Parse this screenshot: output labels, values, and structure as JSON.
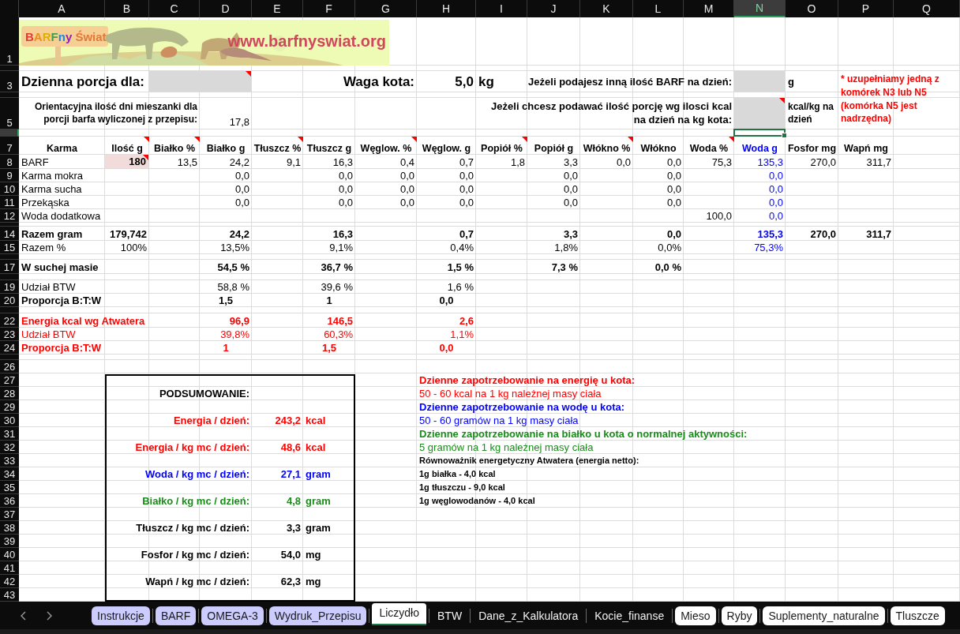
{
  "column_headers": [
    {
      "label": "A",
      "selected": false
    },
    {
      "label": "B",
      "selected": false
    },
    {
      "label": "C",
      "selected": false
    },
    {
      "label": "D",
      "selected": false
    },
    {
      "label": "E",
      "selected": false
    },
    {
      "label": "F",
      "selected": false
    },
    {
      "label": "G",
      "selected": false
    },
    {
      "label": "H",
      "selected": false
    },
    {
      "label": "I",
      "selected": false
    },
    {
      "label": "J",
      "selected": false
    },
    {
      "label": "K",
      "selected": false
    },
    {
      "label": "L",
      "selected": false
    },
    {
      "label": "M",
      "selected": false
    },
    {
      "label": "N",
      "selected": true
    },
    {
      "label": "O",
      "selected": false
    },
    {
      "label": "P",
      "selected": false
    },
    {
      "label": "Q",
      "selected": false
    }
  ],
  "row_headers": [
    {
      "label": "1",
      "selected": false
    },
    {
      "selected": false
    },
    {
      "label": "3",
      "selected": false
    },
    {
      "selected": false
    },
    {
      "label": "5",
      "selected": false
    },
    {
      "selected": true
    },
    {
      "label": "7",
      "selected": false
    },
    {
      "label": "8",
      "selected": false
    },
    {
      "label": "9",
      "selected": false
    },
    {
      "label": "10",
      "selected": false
    },
    {
      "label": "11",
      "selected": false
    },
    {
      "label": "12",
      "selected": false
    },
    {
      "selected": false
    },
    {
      "label": "14",
      "selected": false
    },
    {
      "label": "15",
      "selected": false
    },
    {
      "selected": false
    },
    {
      "label": "17",
      "selected": false
    },
    {
      "selected": false
    },
    {
      "label": "19",
      "selected": false
    },
    {
      "label": "20",
      "selected": false
    },
    {
      "selected": false
    },
    {
      "label": "22",
      "selected": false
    },
    {
      "label": "23",
      "selected": false
    },
    {
      "label": "24",
      "selected": false
    },
    {
      "selected": false
    },
    {
      "label": "26",
      "selected": false
    },
    {
      "label": "27",
      "selected": false
    },
    {
      "label": "28",
      "selected": false
    },
    {
      "label": "29",
      "selected": false
    },
    {
      "label": "30",
      "selected": false
    },
    {
      "label": "31",
      "selected": false
    },
    {
      "label": "32",
      "selected": false
    },
    {
      "label": "33",
      "selected": false
    },
    {
      "label": "34",
      "selected": false
    },
    {
      "label": "35",
      "selected": false
    },
    {
      "label": "36",
      "selected": false
    },
    {
      "label": "37",
      "selected": false
    },
    {
      "label": "38",
      "selected": false
    },
    {
      "label": "39",
      "selected": false
    },
    {
      "label": "40",
      "selected": false
    },
    {
      "label": "41",
      "selected": false
    },
    {
      "label": "42",
      "selected": false
    },
    {
      "label": "43",
      "selected": false
    }
  ],
  "banner": {
    "logo_text": "BARFny Świat",
    "url": "www.barfnyswiat.org"
  },
  "form": {
    "portion_label": "Dzienna porcja dla:",
    "portion_input": {
      "comment": true
    },
    "weight_label": "Waga kota:",
    "weight_value": "5,0",
    "weight_unit": "kg",
    "barf_label": "Jeżeli podajesz inną ilość BARF na dzień:",
    "barf_input": {
      "comment": false
    },
    "barf_unit": "g",
    "days_label": "Orientacyjna ilość dni mieszanki dla porcji barfa wyliczonej z przepisu:",
    "days_value": "17,8",
    "kcal_label": "Jeżeli chcesz podawać ilość porcję wg ilosci kcal na dzień na kg kota:",
    "kcal_input": {
      "comment": true
    },
    "kcal_unit": "kcal/kg na dzień",
    "note": "* uzupełniamy jedną z komórek N3 lub N5 (komórka N5 jest nadrzędna)"
  },
  "table": {
    "columns": [
      {
        "label": "Karma",
        "comment": false,
        "color": "#000000"
      },
      {
        "label": "Ilość g",
        "comment": true,
        "color": "#000000"
      },
      {
        "label": "Białko %",
        "comment": true,
        "color": "#000000"
      },
      {
        "label": "Białko g",
        "comment": false,
        "color": "#000000"
      },
      {
        "label": "Tłuszcz %",
        "comment": true,
        "color": "#000000"
      },
      {
        "label": "Tłuszcz g",
        "comment": false,
        "color": "#000000"
      },
      {
        "label": "Węglow. %",
        "comment": true,
        "color": "#000000"
      },
      {
        "label": "Węglow. g",
        "comment": false,
        "color": "#000000"
      },
      {
        "label": "Popiół %",
        "comment": true,
        "color": "#000000"
      },
      {
        "label": "Popiół g",
        "comment": false,
        "color": "#000000"
      },
      {
        "label": "Włókno %",
        "comment": true,
        "color": "#000000"
      },
      {
        "label": "Włókno",
        "comment": false,
        "color": "#000000"
      },
      {
        "label": "Woda %",
        "comment": true,
        "color": "#000000"
      },
      {
        "label": "Woda g",
        "comment": false,
        "color": "#0000ff"
      },
      {
        "label": "Fosfor mg",
        "comment": false,
        "color": "#000000"
      },
      {
        "label": "Wapń mg",
        "comment": false,
        "color": "#000000"
      }
    ],
    "rows": [
      {
        "kind": "normal",
        "label": "BARF",
        "values": {
          "qty_g": {
            "text": "180",
            "input": true,
            "comment": true
          },
          "protein_pct": "13,5",
          "protein_g": "24,2",
          "fat_pct": "9,1",
          "fat_g": "16,3",
          "carb_pct": "0,4",
          "carb_g": "0,7",
          "ash_pct": "1,8",
          "ash_g": "3,3",
          "fiber_pct": "0,0",
          "fiber": "0,0",
          "water_pct": "75,3",
          "water_g": "135,3",
          "phosphorus_mg": "270,0",
          "calcium_mg": "311,7"
        }
      },
      {
        "kind": "normal",
        "label": "Karma mokra",
        "values": {
          "protein_g": "0,0",
          "fat_g": "0,0",
          "carb_pct": "0,0",
          "carb_g": "0,0",
          "ash_g": "0,0",
          "fiber": "0,0",
          "water_g": "0,0"
        }
      },
      {
        "kind": "normal",
        "label": "Karma sucha",
        "values": {
          "protein_g": "0,0",
          "fat_g": "0,0",
          "carb_pct": "0,0",
          "carb_g": "0,0",
          "ash_g": "0,0",
          "fiber": "0,0",
          "water_g": "0,0"
        }
      },
      {
        "kind": "normal",
        "label": "Przekąska",
        "values": {
          "protein_g": "0,0",
          "fat_g": "0,0",
          "carb_pct": "0,0",
          "carb_g": "0,0",
          "ash_g": "0,0",
          "fiber": "0,0",
          "water_g": "0,0"
        }
      },
      {
        "kind": "normal",
        "label": "Woda dodatkowa",
        "values": {
          "water_pct": "100,0",
          "water_g": "0,0"
        }
      },
      {
        "kind": "spacer"
      },
      {
        "kind": "bold",
        "label": "Razem gram",
        "values": {
          "qty_g": "179,742",
          "protein_g": "24,2",
          "fat_g": "16,3",
          "carb_g": "0,7",
          "ash_g": "3,3",
          "fiber": "0,0",
          "water_g": "135,3",
          "phosphorus_mg": "270,0",
          "calcium_mg": "311,7"
        }
      },
      {
        "kind": "normal",
        "label": "Razem %",
        "values": {
          "qty_g": "100%",
          "protein_g": "13,5%",
          "fat_g": "9,1%",
          "carb_g": "0,4%",
          "ash_g": "1,8%",
          "fiber": "0,0%",
          "water_g": "75,3%"
        }
      },
      {
        "kind": "spacer"
      },
      {
        "kind": "bold",
        "label": "W suchej masie",
        "values": {
          "protein_g": "54,5 %",
          "fat_g": "36,7 %",
          "carb_g": "1,5 %",
          "ash_g": "7,3 %",
          "fiber": "0,0 %"
        }
      },
      {
        "kind": "spacer"
      },
      {
        "kind": "normal",
        "label": "Udział BTW",
        "values": {
          "protein_g": "58,8 %",
          "fat_g": "39,6 %",
          "carb_g": "1,6 %"
        }
      },
      {
        "kind": "ratio",
        "label": "Proporcja B:T:W",
        "values": {
          "protein_g": "1,5",
          "fat_g": "1",
          "carb_g": "0,0"
        }
      },
      {
        "kind": "spacer"
      },
      {
        "kind": "red-bold",
        "label": "Energia kcal wg Atwatera",
        "values": {
          "protein_g": "96,9",
          "fat_g": "146,5",
          "carb_g": "2,6"
        }
      },
      {
        "kind": "red",
        "label": "Udział BTW",
        "values": {
          "protein_g": "39,8%",
          "fat_g": "60,3%",
          "carb_g": "1,1%"
        }
      },
      {
        "kind": "red-ratio",
        "label": "Proporcja B:T:W",
        "values": {
          "protein_g": "1",
          "fat_g": "1,5",
          "carb_g": "0,0"
        }
      }
    ]
  },
  "summary": {
    "title": "PODSUMOWANIE:",
    "items": [
      {
        "label": "Energia / dzień:",
        "value": "243,2",
        "unit": "kcal",
        "color": "#ff0000"
      },
      {
        "label": "Energia / kg mc / dzień:",
        "value": "48,6",
        "unit": "kcal",
        "color": "#ff0000"
      },
      {
        "label": "Woda / kg mc / dzień:",
        "value": "27,1",
        "unit": "gram",
        "color": "#0000ff"
      },
      {
        "label": "Białko / kg mc / dzień:",
        "value": "4,8",
        "unit": "gram",
        "color": "#1a8c1a"
      },
      {
        "label": "Tłuszcz / kg mc / dzień:",
        "value": "3,3",
        "unit": "gram",
        "color": "#000000"
      },
      {
        "label": "Fosfor / kg mc / dzień:",
        "value": "54,0",
        "unit": "mg",
        "color": "#000000"
      },
      {
        "label": "Wapń / kg mc / dzień:",
        "value": "62,3",
        "unit": "mg",
        "color": "#000000"
      }
    ]
  },
  "info": [
    {
      "kind": "heading",
      "text": "Dzienne zapotrzebowanie na energię u kota:",
      "color": "#ff0000"
    },
    {
      "kind": "text",
      "text": "50 - 60 kcal na 1 kg należnej masy ciała",
      "color": "#ff0000"
    },
    {
      "kind": "heading",
      "text": "Dzienne zapotrzebowanie na wodę u kota:",
      "color": "#0000ff"
    },
    {
      "kind": "text",
      "text": "50 - 60 gramów na 1 kg masy ciała",
      "color": "#0000ff"
    },
    {
      "kind": "heading",
      "text": "Dzienne zapotrzebowanie na białko u kota o normalnej aktywności:",
      "color": "#1a8c1a"
    },
    {
      "kind": "text",
      "text": "5 gramów na 1 kg należnej masy ciała",
      "color": "#1a8c1a"
    },
    {
      "kind": "note-heading",
      "text": "Równoważnik energetyczny Atwatera (energia netto):",
      "color": "#000000"
    },
    {
      "kind": "note",
      "text": "1g białka - 4,0 kcal",
      "color": "#000000"
    },
    {
      "kind": "note",
      "text": "1g tłuszczu - 9,0 kcal",
      "color": "#000000"
    },
    {
      "kind": "note",
      "text": "1g węglowodanów - 4,0 kcal",
      "color": "#000000"
    }
  ],
  "sheet_tabs": [
    {
      "label": "Instrukcje",
      "selected": false,
      "color": "#ccccff"
    },
    {
      "label": "BARF",
      "selected": false,
      "color": "#ccccff"
    },
    {
      "label": "OMEGA-3",
      "selected": false,
      "color": "#ccccff"
    },
    {
      "label": "Wydruk_Przepisu",
      "selected": false,
      "color": "#ccccff"
    },
    {
      "label": "Liczydło",
      "selected": true
    },
    {
      "label": "BTW",
      "selected": false
    },
    {
      "label": "Dane_z_Kalkulatora",
      "selected": false
    },
    {
      "label": "Kocie_finanse",
      "selected": false
    },
    {
      "label": "Mieso",
      "selected": false,
      "color": "#ffffff"
    },
    {
      "label": "Ryby",
      "selected": false,
      "color": "#ffffff"
    },
    {
      "label": "Suplementy_naturalne",
      "selected": false,
      "color": "#ffffff"
    },
    {
      "label": "Tluszcze",
      "selected": false,
      "color": "#ffffff"
    }
  ]
}
